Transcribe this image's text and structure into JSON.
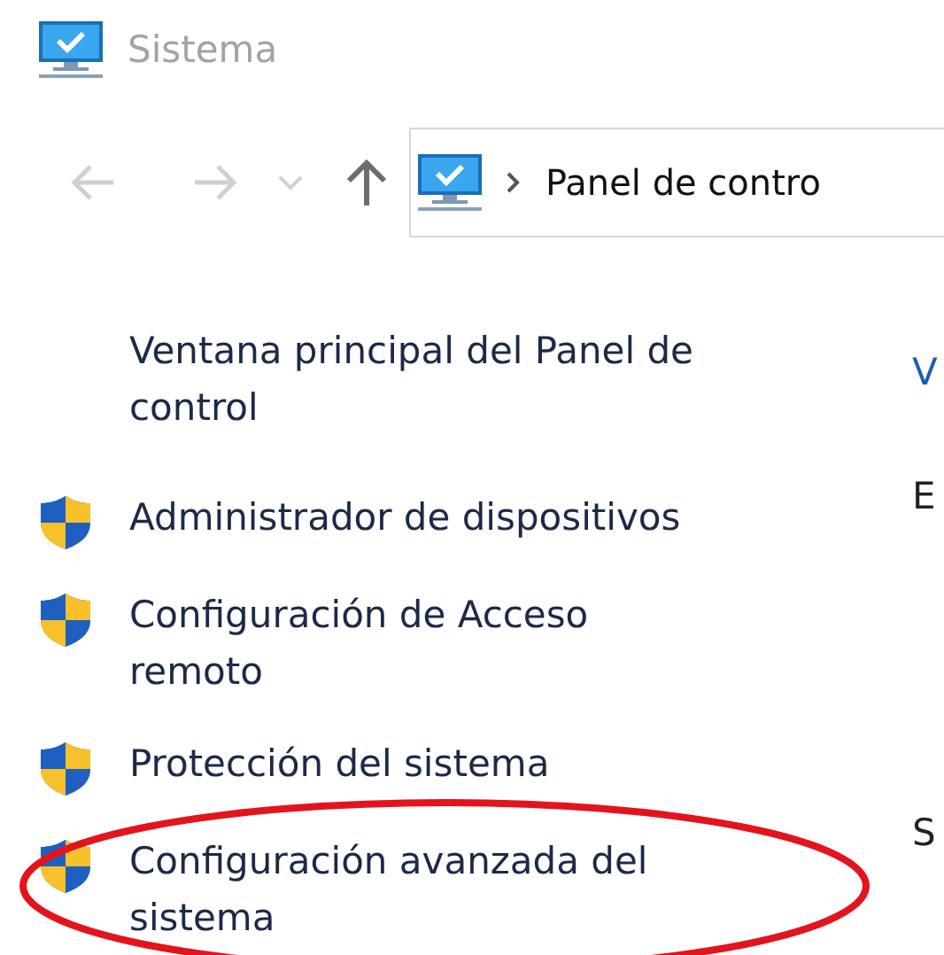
{
  "window": {
    "title": "Sistema"
  },
  "navigation": {
    "back": {
      "disabled": true
    },
    "forward": {
      "disabled": true
    },
    "recent": {
      "disabled": true
    },
    "up": {
      "disabled": false
    }
  },
  "address_bar": {
    "breadcrumb": "Panel de contro"
  },
  "sidebar": {
    "items": [
      {
        "kind": "link",
        "label": "Ventana principal del Panel de control",
        "highlighted": false
      },
      {
        "kind": "shield-link",
        "label": "Administrador de dispositivos",
        "highlighted": false
      },
      {
        "kind": "shield-link",
        "label": "Configuración de Acceso remoto",
        "highlighted": false
      },
      {
        "kind": "shield-link",
        "label": "Protección del sistema",
        "highlighted": false
      },
      {
        "kind": "shield-link",
        "label": "Configuración avanzada del sistema",
        "highlighted": true
      }
    ]
  },
  "main": {
    "texts": [
      {
        "kind": "heading",
        "text": "V"
      },
      {
        "kind": "body",
        "text": "E"
      },
      {
        "kind": "body",
        "text": "S"
      }
    ]
  }
}
